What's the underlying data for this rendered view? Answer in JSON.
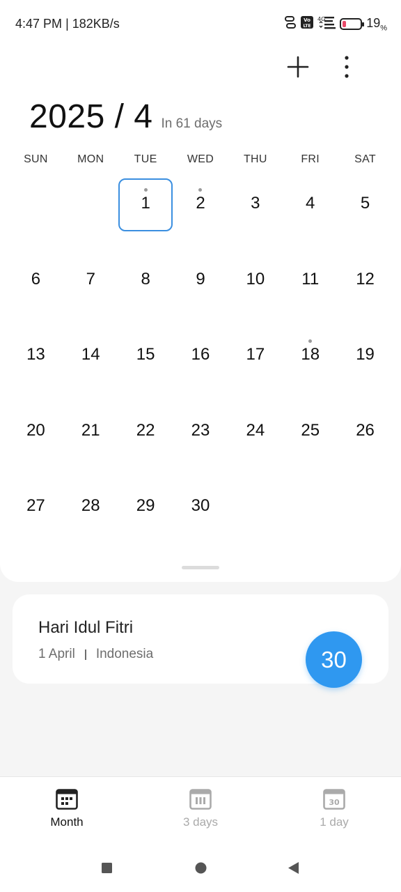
{
  "status_bar": {
    "time": "4:47 PM",
    "network_speed": "182KB/s",
    "separator": "|",
    "volte_label": "Vo\nLTE",
    "network_label": "4G",
    "battery_percent": "19",
    "battery_unit": "%",
    "battery_level": 0.19,
    "battery_color": "#e94b6a"
  },
  "toolbar": {
    "add_icon": "plus-icon",
    "more_icon": "more-vertical-icon"
  },
  "header": {
    "month_title": "2025 / 4",
    "relative_days": "In 61 days"
  },
  "calendar": {
    "weekdays": [
      "SUN",
      "MON",
      "TUE",
      "WED",
      "THU",
      "FRI",
      "SAT"
    ],
    "leading_blanks": 2,
    "days": [
      1,
      2,
      3,
      4,
      5,
      6,
      7,
      8,
      9,
      10,
      11,
      12,
      13,
      14,
      15,
      16,
      17,
      18,
      19,
      20,
      21,
      22,
      23,
      24,
      25,
      26,
      27,
      28,
      29,
      30
    ],
    "selected_day": 1,
    "event_days": [
      1,
      2,
      18
    ],
    "selection_color": "#3b8fe0"
  },
  "event": {
    "title": "Hari Idul Fitri",
    "date": "1 April",
    "region": "Indonesia"
  },
  "today_button": {
    "label": "30",
    "color": "#2f98f0"
  },
  "bottom_nav": {
    "items": [
      {
        "label": "Month",
        "icon": "month-grid-icon",
        "active": true
      },
      {
        "label": "3 days",
        "icon": "three-days-icon",
        "active": false
      },
      {
        "label": "1 day",
        "icon": "one-day-icon",
        "icon_text": "30",
        "active": false
      }
    ]
  },
  "system_nav": {
    "recents_icon": "square-icon",
    "home_icon": "circle-icon",
    "back_icon": "triangle-back-icon"
  }
}
